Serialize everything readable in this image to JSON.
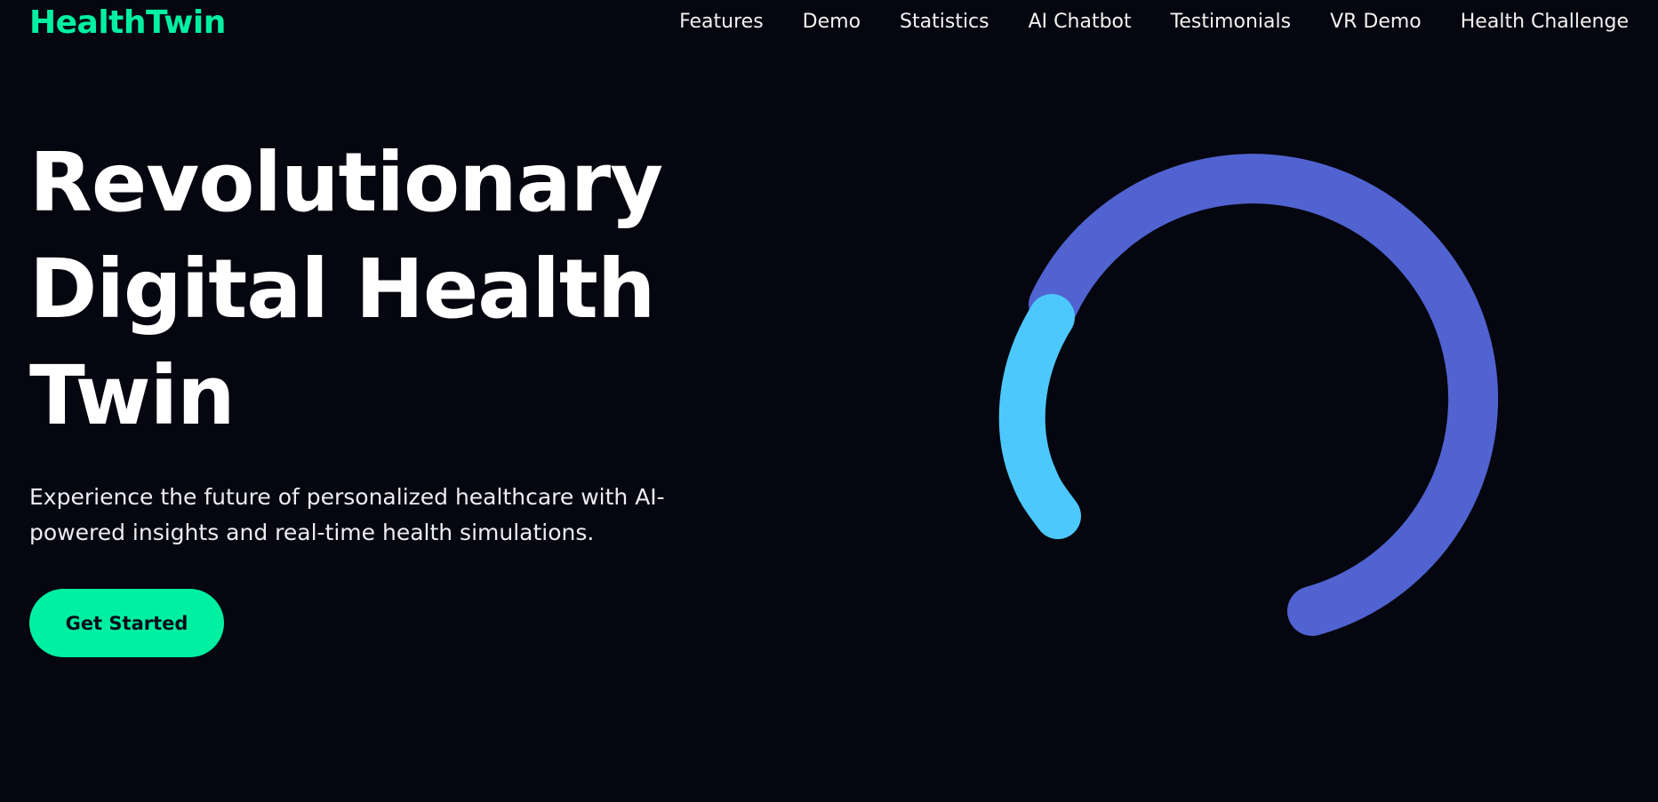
{
  "brand": {
    "name": "HealthTwin",
    "accent_color": "#00f0a2"
  },
  "nav": {
    "items": [
      "Features",
      "Demo",
      "Statistics",
      "AI Chatbot",
      "Testimonials",
      "VR Demo",
      "Health Challenge"
    ]
  },
  "hero": {
    "title_lines": [
      "Revolutionary",
      "Digital Health",
      "Twin"
    ],
    "subtitle_lines": [
      "Experience the future of personalized healthcare with AI-",
      "powered insights and real-time health simulations."
    ],
    "cta_label": "Get Started"
  },
  "loader": {
    "arcs": [
      {
        "name": "outer-arc",
        "color": "#5063d0"
      },
      {
        "name": "inner-arc",
        "color": "#4dc8fc"
      }
    ]
  },
  "colors": {
    "background": "#05060f",
    "text": "#ffffff"
  }
}
